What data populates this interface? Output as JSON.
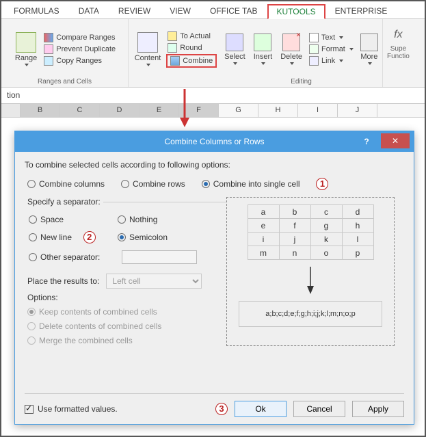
{
  "tabs": [
    "FORMULAS",
    "DATA",
    "REVIEW",
    "VIEW",
    "OFFICE TAB",
    "KUTOOLS",
    "ENTERPRISE"
  ],
  "active_tab": "KUTOOLS",
  "ribbon": {
    "range": "Range",
    "compare": "Compare Ranges",
    "prevent": "Prevent Duplicate",
    "copy": "Copy Ranges",
    "group1": "Ranges and Cells",
    "content": "Content",
    "actual": "To Actual",
    "round": "Round",
    "combine": "Combine",
    "select": "Select",
    "insert": "Insert",
    "delete": "Delete",
    "text": "Text",
    "format": "Format",
    "link": "Link",
    "more": "More",
    "supe": "Supe",
    "function": "Functio",
    "group2": "Editing"
  },
  "formula_bar": "tion",
  "columns": [
    "B",
    "C",
    "D",
    "E",
    "F",
    "G",
    "H",
    "I",
    "J"
  ],
  "selected_cols": [
    "B",
    "C",
    "D",
    "E",
    "F"
  ],
  "dlg": {
    "title": "Combine Columns or Rows",
    "intro": "To combine selected cells according to following options:",
    "mode": {
      "cols": "Combine columns",
      "rows": "Combine rows",
      "single": "Combine into single cell"
    },
    "sep_legend": "Specify a separator:",
    "sep": {
      "space": "Space",
      "nothing": "Nothing",
      "newline": "New line",
      "semicolon": "Semicolon",
      "other": "Other separator:"
    },
    "place_label": "Place the results to:",
    "place_value": "Left cell",
    "opts_label": "Options:",
    "opts": {
      "keep": "Keep contents of combined cells",
      "del": "Delete contents of combined cells",
      "merge": "Merge the combined cells"
    },
    "preview_rows": [
      [
        "a",
        "b",
        "c",
        "d"
      ],
      [
        "e",
        "f",
        "g",
        "h"
      ],
      [
        "i",
        "j",
        "k",
        "l"
      ],
      [
        "m",
        "n",
        "o",
        "p"
      ]
    ],
    "preview_result": "a;b;c;d;e;f;g;h;i;j;k;l;m;n;o;p",
    "use_fmt": "Use formatted values.",
    "ok": "Ok",
    "cancel": "Cancel",
    "apply": "Apply",
    "help": "?",
    "close": "✕",
    "badges": {
      "b1": "1",
      "b2": "2",
      "b3": "3"
    }
  }
}
